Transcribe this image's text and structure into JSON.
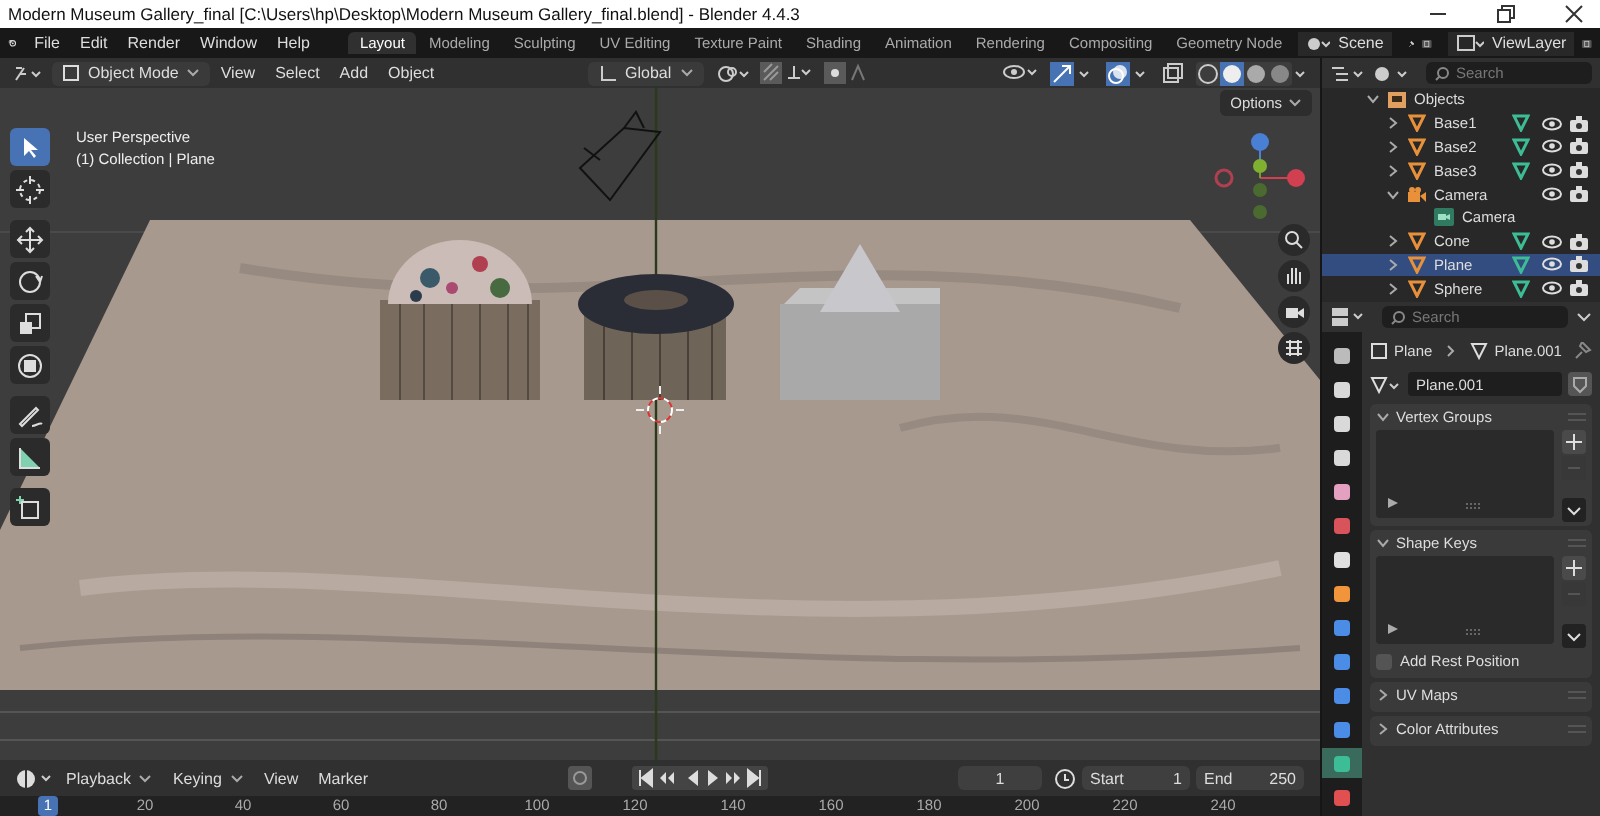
{
  "window": {
    "title": "Modern Museum Gallery_final [C:\\Users\\hp\\Desktop\\Modern Museum Gallery_final.blend] - Blender 4.4.3"
  },
  "menu": [
    "File",
    "Edit",
    "Render",
    "Window",
    "Help"
  ],
  "workspaces": [
    {
      "label": "Layout",
      "selected": true
    },
    {
      "label": "Modeling",
      "selected": false
    },
    {
      "label": "Sculpting",
      "selected": false
    },
    {
      "label": "UV Editing",
      "selected": false
    },
    {
      "label": "Texture Paint",
      "selected": false
    },
    {
      "label": "Shading",
      "selected": false
    },
    {
      "label": "Animation",
      "selected": false
    },
    {
      "label": "Rendering",
      "selected": false
    },
    {
      "label": "Compositing",
      "selected": false
    },
    {
      "label": "Geometry Node",
      "selected": false
    }
  ],
  "scene": "Scene",
  "view_layer": "ViewLayer",
  "header": {
    "mode": "Object Mode",
    "menus": [
      "View",
      "Select",
      "Add",
      "Object"
    ],
    "orientation": "Global"
  },
  "viewport": {
    "overlay_lines": [
      "User Perspective",
      "(1) Collection | Plane"
    ],
    "options": "Options"
  },
  "tools": [
    {
      "kind": "select",
      "selected": true
    },
    {
      "kind": "cursor",
      "selected": false
    },
    {
      "kind": "move",
      "selected": false
    },
    {
      "kind": "rotate",
      "selected": false
    },
    {
      "kind": "scale",
      "selected": false
    },
    {
      "kind": "transform",
      "selected": false
    },
    {
      "kind": "annotate",
      "selected": false
    },
    {
      "kind": "measure",
      "selected": false
    },
    {
      "kind": "add-cube",
      "selected": false
    }
  ],
  "outliner": {
    "search": {
      "placeholder": "Search"
    },
    "items": [
      {
        "label": "Objects",
        "kind": "collection",
        "expanded": true,
        "selected": false,
        "children": [
          {
            "label": "Base1",
            "kind": "mesh",
            "expanded": false,
            "selected": false
          },
          {
            "label": "Base2",
            "kind": "mesh",
            "expanded": false,
            "selected": false
          },
          {
            "label": "Base3",
            "kind": "mesh",
            "expanded": false,
            "selected": false
          },
          {
            "label": "Camera",
            "kind": "camera",
            "expanded": true,
            "selected": false,
            "children": [
              {
                "label": "Camera",
                "kind": "camera-data",
                "selected": false
              }
            ]
          },
          {
            "label": "Cone",
            "kind": "mesh",
            "expanded": false,
            "selected": false
          },
          {
            "label": "Plane",
            "kind": "mesh",
            "expanded": false,
            "selected": true
          },
          {
            "label": "Sphere",
            "kind": "mesh",
            "expanded": false,
            "selected": false
          }
        ]
      }
    ]
  },
  "properties": {
    "search": {
      "placeholder": "Search"
    },
    "breadcrumb": [
      "Plane",
      "Plane.001"
    ],
    "data_name": "Plane.001",
    "tabs": [
      {
        "kind": "tool",
        "selected": false
      },
      {
        "kind": "render",
        "selected": false
      },
      {
        "kind": "output",
        "selected": false
      },
      {
        "kind": "view-layer",
        "selected": false
      },
      {
        "kind": "scene",
        "selected": false
      },
      {
        "kind": "world",
        "selected": false
      },
      {
        "kind": "collection",
        "selected": false
      },
      {
        "kind": "object",
        "selected": false
      },
      {
        "kind": "modifiers",
        "selected": false
      },
      {
        "kind": "particles",
        "selected": false
      },
      {
        "kind": "physics",
        "selected": false
      },
      {
        "kind": "constraints",
        "selected": false
      },
      {
        "kind": "data",
        "selected": true
      },
      {
        "kind": "material",
        "selected": false
      }
    ],
    "panels": [
      {
        "title": "Vertex Groups",
        "expanded": true
      },
      {
        "title": "Shape Keys",
        "expanded": true,
        "checkbox": {
          "label": "Add Rest Position",
          "checked": false
        }
      },
      {
        "title": "UV Maps",
        "expanded": false
      },
      {
        "title": "Color Attributes",
        "expanded": false
      }
    ]
  },
  "timeline": {
    "menus": [
      "Playback",
      "Keying",
      "View",
      "Marker"
    ],
    "current_frame": "1",
    "start": {
      "label": "Start",
      "value": "1"
    },
    "end": {
      "label": "End",
      "value": "250"
    },
    "ruler": [
      {
        "label": "1",
        "selected": true
      },
      {
        "label": "20",
        "selected": false
      },
      {
        "label": "40",
        "selected": false
      },
      {
        "label": "60",
        "selected": false
      },
      {
        "label": "80",
        "selected": false
      },
      {
        "label": "100",
        "selected": false
      },
      {
        "label": "120",
        "selected": false
      },
      {
        "label": "140",
        "selected": false
      },
      {
        "label": "160",
        "selected": false
      },
      {
        "label": "180",
        "selected": false
      },
      {
        "label": "200",
        "selected": false
      },
      {
        "label": "220",
        "selected": false
      },
      {
        "label": "240",
        "selected": false
      }
    ]
  }
}
